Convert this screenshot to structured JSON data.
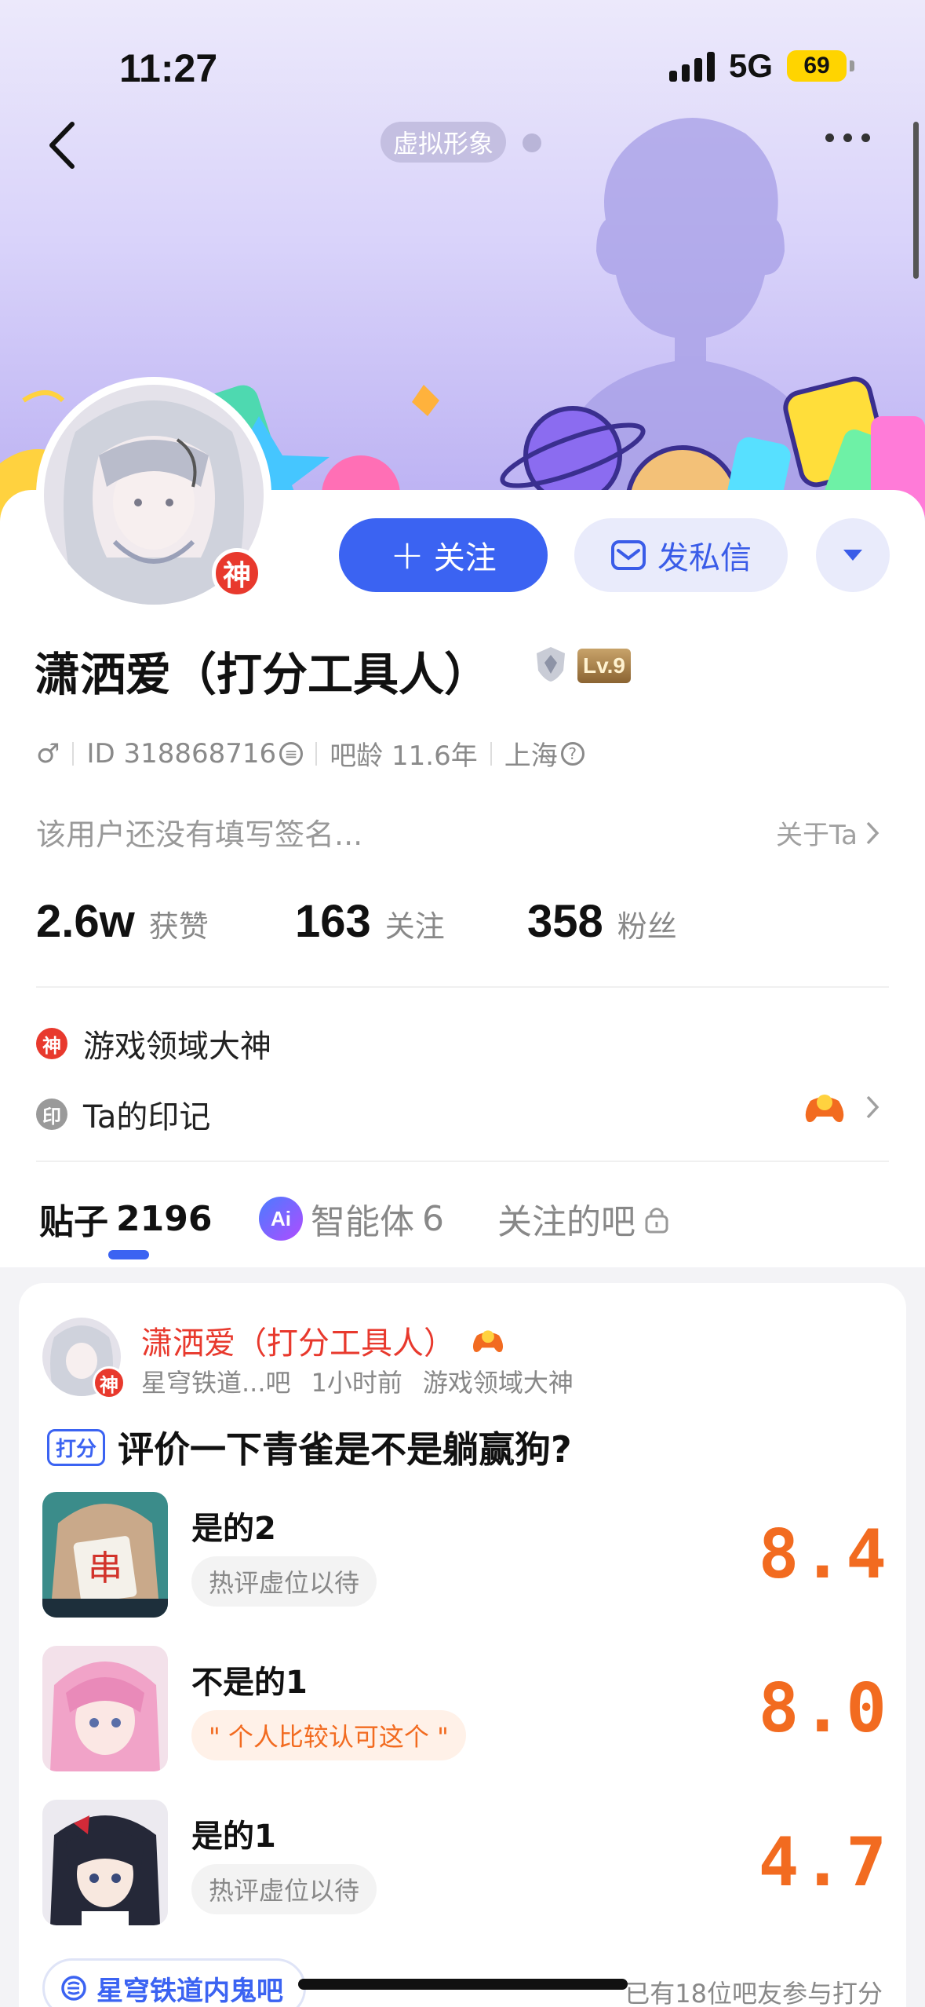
{
  "status_bar": {
    "time": "11:27",
    "network": "5G",
    "battery": "69"
  },
  "header": {
    "avatar_pill": "虚拟形象"
  },
  "profile": {
    "god_badge": "神",
    "follow_label": "关注",
    "message_label": "发私信",
    "name": "潇洒爱（打分工具人）",
    "level": "Lv.9",
    "gender_symbol": "♂",
    "id_text": "ID 318868716",
    "bar_age": "吧龄 11.6年",
    "location": "上海",
    "signature": "该用户还没有填写签名...",
    "about": "关于Ta",
    "stats": [
      {
        "num": "2.6w",
        "label": "获赞"
      },
      {
        "num": "163",
        "label": "关注"
      },
      {
        "num": "358",
        "label": "粉丝"
      }
    ],
    "honors": [
      {
        "icon": "神",
        "label": "游戏领域大神"
      },
      {
        "icon": "印",
        "label": "Ta的印记"
      }
    ]
  },
  "tabs": [
    {
      "label": "贴子",
      "count": "2196"
    },
    {
      "label": "智能体",
      "count": "6",
      "icon": "Ai"
    },
    {
      "label": "关注的吧"
    }
  ],
  "post": {
    "author": "潇洒爱（打分工具人）",
    "badge": "神",
    "forum": "星穹铁道...吧",
    "time": "1小时前",
    "honor": "游戏领域大神",
    "tag": "打分",
    "title": "评价一下青雀是不是躺赢狗?",
    "items": [
      {
        "name": "是的2",
        "comment": "热评虚位以待",
        "score": "8.4",
        "comment_style": "grey"
      },
      {
        "name": "不是的1",
        "comment": "\" 个人比较认可这个 \"",
        "score": "8.0",
        "comment_style": "orange"
      },
      {
        "name": "是的1",
        "comment": "热评虚位以待",
        "score": "4.7",
        "comment_style": "grey"
      }
    ],
    "bar_name": "星穹铁道内鬼吧",
    "participants": "已有18位吧友参与打分"
  },
  "colors": {
    "accent": "#3b63f2",
    "score": "#f26b20",
    "god_red": "#e8392d"
  }
}
